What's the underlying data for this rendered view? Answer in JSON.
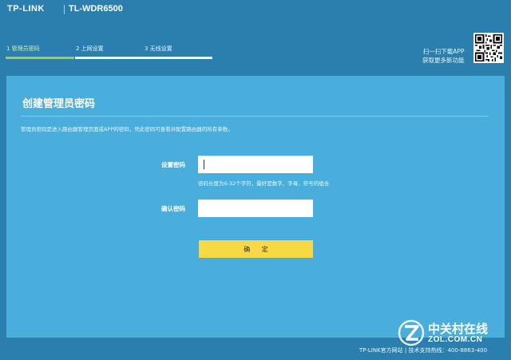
{
  "header": {
    "brand": "TP-LINK",
    "model": "TL-WDR6500"
  },
  "steps": [
    {
      "label": "1 管理员密码",
      "active": true
    },
    {
      "label": "2 上网设置",
      "active": false
    },
    {
      "label": "3 无线设置",
      "active": false
    }
  ],
  "app_promo": {
    "line1": "扫一扫下载APP",
    "line2": "获取更多新功能"
  },
  "panel": {
    "title": "创建管理员密码",
    "description": "管理员密码是进入路由器管理页面或APP的密码，凭此密码可查看并配置路由器的所有参数。",
    "password_label": "设置密码",
    "password_value": "",
    "password_hint": "密码长度为6-32个字符，最好是数字、字母、符号的组合",
    "confirm_label": "确认密码",
    "confirm_value": "",
    "ok_label": "确 定"
  },
  "footer": {
    "text": "TP-LINK官方网站 | 技术支持热线：400-8863-400"
  },
  "watermark": {
    "cn": "中关村在线",
    "en": "ZOL.COM.CN"
  },
  "colors": {
    "background": "#2a7fae",
    "panel": "#4aaedc",
    "active_step": "#9ad04a",
    "button": "#f7d845"
  }
}
